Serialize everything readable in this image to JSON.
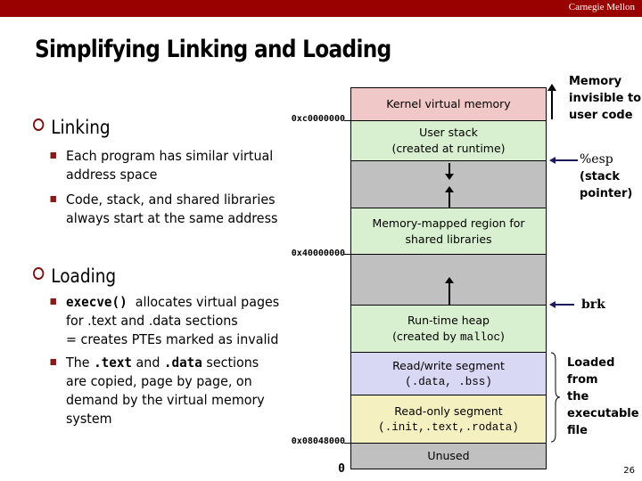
{
  "header": {
    "brand": "Carnegie Mellon"
  },
  "title": "Simplifying Linking and Loading",
  "bullets": [
    {
      "label": "Linking",
      "items": [
        {
          "lines": [
            "Each program has similar virtual",
            "address space"
          ]
        },
        {
          "lines": [
            "Code, stack, and shared libraries",
            "always start at the same address"
          ]
        }
      ]
    },
    {
      "label": "Loading",
      "items": [
        {
          "code": "execve()",
          "lines": [
            "allocates virtual pages",
            "for .text and .data sections",
            "= creates PTEs marked as invalid"
          ]
        },
        {
          "prefix": "The",
          "code1": ".text",
          "mid": "and",
          "code2": ".data",
          "suffix": "sections",
          "lines": [
            "are copied, page by page, on",
            "demand by the virtual memory",
            "system"
          ]
        }
      ]
    }
  ],
  "addresses": {
    "kernel_start": "0xc0000000",
    "mmap_start": "0x40000000",
    "text_start": "0x08048000",
    "zero": "0"
  },
  "memory_layout": {
    "segments": [
      {
        "name": "kernel",
        "line1": "Kernel virtual memory",
        "line2": "",
        "color": "#f0c8c8"
      },
      {
        "name": "user-stack",
        "line1": "User stack",
        "line2": "(created at runtime)",
        "color": "#d8f0d0"
      },
      {
        "name": "gap-stack",
        "line1": "",
        "line2": "",
        "color": "#c0c0c0"
      },
      {
        "name": "mmap",
        "line1": "Memory-mapped region for",
        "line2": "shared libraries",
        "color": "#d8f0d0"
      },
      {
        "name": "gap-heap",
        "line1": "",
        "line2": "",
        "color": "#c0c0c0"
      },
      {
        "name": "heap",
        "line1": "Run-time heap",
        "line2_pre": "(created by ",
        "line2_code": "malloc",
        "line2_post": ")",
        "color": "#d8f0d0"
      },
      {
        "name": "rw",
        "line1": "Read/write segment",
        "line2": "(.data, .bss)",
        "color": "#d8d8f4"
      },
      {
        "name": "ro",
        "line1": "Read-only segment",
        "line2": "(.init,.text,.rodata)",
        "color": "#f4f0c0"
      },
      {
        "name": "unused",
        "line1": "Unused",
        "line2": "",
        "color": "#c0c0c0"
      }
    ]
  },
  "annotations": {
    "invisible": [
      "Memory",
      "invisible to",
      "user code"
    ],
    "esp_label": "%esp",
    "esp_desc": [
      "(stack",
      "pointer)"
    ],
    "brk_label": "brk",
    "loaded": [
      "Loaded",
      "from",
      "the",
      "executable",
      "file"
    ]
  },
  "page_number": "26"
}
